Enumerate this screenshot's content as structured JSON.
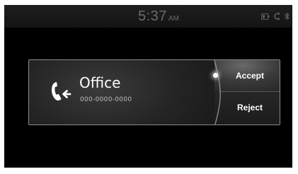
{
  "status_bar": {
    "time": "5:37",
    "am_pm": "AM",
    "icons": [
      "battery-icon",
      "phone-signal-icon",
      "bluetooth-icon"
    ]
  },
  "call": {
    "caller_name": "Office",
    "caller_number": "000-0000-0000",
    "icon": "incoming-call-icon",
    "accept_label": "Accept",
    "reject_label": "Reject"
  },
  "colors": {
    "background": "#000000",
    "card": "#242424",
    "text": "#ffffff"
  }
}
